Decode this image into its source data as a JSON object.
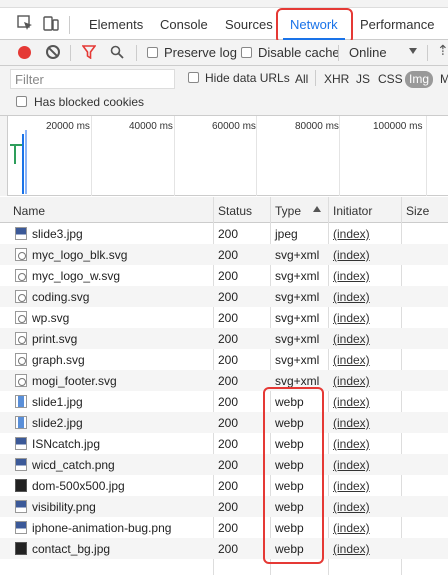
{
  "tabs": [
    {
      "label": "Elements"
    },
    {
      "label": "Console"
    },
    {
      "label": "Sources"
    },
    {
      "label": "Network"
    },
    {
      "label": "Performance"
    }
  ],
  "active_tab": "Network",
  "toolbar": {
    "preserve_log": "Preserve log",
    "disable_cache": "Disable cache",
    "throttle": "Online"
  },
  "filter": {
    "placeholder": "Filter",
    "hide_data_urls": "Hide data URLs",
    "types": [
      "All",
      "XHR",
      "JS",
      "CSS",
      "Img",
      "M"
    ],
    "active_type": "Img",
    "has_blocked_cookies": "Has blocked cookies"
  },
  "overview": {
    "ticks": [
      "20000 ms",
      "40000 ms",
      "60000 ms",
      "80000 ms",
      "100000 ms"
    ]
  },
  "columns": [
    "Name",
    "Status",
    "Type",
    "Initiator",
    "Size"
  ],
  "rows": [
    {
      "name": "slide3.jpg",
      "status": "200",
      "type": "jpeg",
      "initiator": "(index)",
      "icon": "image-file-icon"
    },
    {
      "name": "myc_logo_blk.svg",
      "status": "200",
      "type": "svg+xml",
      "initiator": "(index)",
      "icon": "svg-file-icon"
    },
    {
      "name": "myc_logo_w.svg",
      "status": "200",
      "type": "svg+xml",
      "initiator": "(index)",
      "icon": "svg-file-icon"
    },
    {
      "name": "coding.svg",
      "status": "200",
      "type": "svg+xml",
      "initiator": "(index)",
      "icon": "svg-file-icon"
    },
    {
      "name": "wp.svg",
      "status": "200",
      "type": "svg+xml",
      "initiator": "(index)",
      "icon": "svg-file-icon"
    },
    {
      "name": "print.svg",
      "status": "200",
      "type": "svg+xml",
      "initiator": "(index)",
      "icon": "svg-file-icon"
    },
    {
      "name": "graph.svg",
      "status": "200",
      "type": "svg+xml",
      "initiator": "(index)",
      "icon": "svg-file-icon"
    },
    {
      "name": "mogi_footer.svg",
      "status": "200",
      "type": "svg+xml",
      "initiator": "(index)",
      "icon": "svg-file-icon"
    },
    {
      "name": "slide1.jpg",
      "status": "200",
      "type": "webp",
      "initiator": "(index)",
      "icon": "image-file-icon"
    },
    {
      "name": "slide2.jpg",
      "status": "200",
      "type": "webp",
      "initiator": "(index)",
      "icon": "image-file-icon"
    },
    {
      "name": "ISNcatch.jpg",
      "status": "200",
      "type": "webp",
      "initiator": "(index)",
      "icon": "image-file-icon"
    },
    {
      "name": "wicd_catch.png",
      "status": "200",
      "type": "webp",
      "initiator": "(index)",
      "icon": "image-file-icon"
    },
    {
      "name": "dom-500x500.jpg",
      "status": "200",
      "type": "webp",
      "initiator": "(index)",
      "icon": "image-file-icon"
    },
    {
      "name": "visibility.png",
      "status": "200",
      "type": "webp",
      "initiator": "(index)",
      "icon": "image-file-icon"
    },
    {
      "name": "iphone-animation-bug.png",
      "status": "200",
      "type": "webp",
      "initiator": "(index)",
      "icon": "image-file-icon"
    },
    {
      "name": "contact_bg.jpg",
      "status": "200",
      "type": "webp",
      "initiator": "(index)",
      "icon": "image-file-icon"
    }
  ],
  "colors": {
    "accent": "#1a73e8",
    "record": "#e53935",
    "highlight": "#e53935"
  }
}
